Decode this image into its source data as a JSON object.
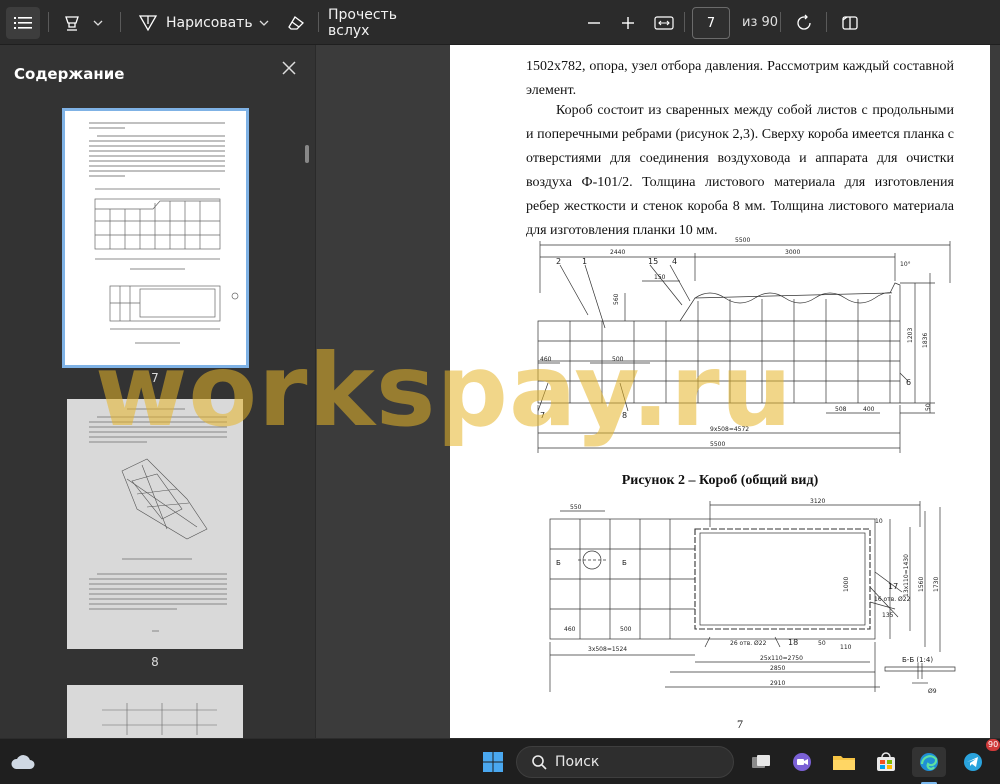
{
  "toolbar": {
    "draw_label": "Нарисовать",
    "read_aloud_label": "Прочесть вслух",
    "current_page": "7",
    "page_total_label": "из 90"
  },
  "sidebar": {
    "title": "Содержание",
    "thumbnails": [
      {
        "page": "7"
      },
      {
        "page": "8"
      }
    ]
  },
  "document": {
    "para1": "1502x782, опора, узел отбора давления. Рассмотрим каждый составной элемент.",
    "para2": "Короб состоит из сваренных между собой листов с продольными и поперечными ребрами (рисунок 2,3). Сверху короба имеется планка с отверстиями для соединения воздуховода и аппарата для очистки воздуха Ф-101/2. Толщина листового материала для изготовления ребер жесткости и стенок короба 8 мм. Толщина листового материала для изготовления планки 10 мм.",
    "figure_caption": "Рисунок 2 – Короб (общий вид)",
    "page_number": "7",
    "drawing1_labels": {
      "d5500": "5500",
      "d2440": "2440",
      "d3000": "3000",
      "d560": "560",
      "d150": "150",
      "d460": "460",
      "d500": "500",
      "d1203": "1203",
      "d1836": "1836",
      "d508": "508",
      "d400": "400",
      "d9x": "9x508=4572",
      "d5500b": "5500",
      "d10": "10°",
      "n1": "1",
      "n2": "2",
      "n4": "4",
      "n6": "6",
      "n7": "7",
      "n8": "8",
      "n15": "15",
      "d50": "50"
    },
    "drawing2_labels": {
      "d550": "550",
      "d3120": "3120",
      "d460": "460",
      "d500": "500",
      "d3x": "3x508=1524",
      "d26": "26 отв. Ø22",
      "d18": "18",
      "d17": "17",
      "d16": "16 отв. Ø22",
      "d25x": "25x110=2750",
      "d2850": "2850",
      "d2910": "2910",
      "d1000": "1000",
      "d1730": "1730",
      "d1560": "1560",
      "d13x": "13x110=1430",
      "bb": "Б-Б (1:4)",
      "b": "Б",
      "d9": "Ø9",
      "d135": "135",
      "d50": "50",
      "d110": "110",
      "d10": "10"
    }
  },
  "watermark": "workspay.ru",
  "taskbar": {
    "search_placeholder": "Поиск",
    "telegram_badge": "90"
  }
}
